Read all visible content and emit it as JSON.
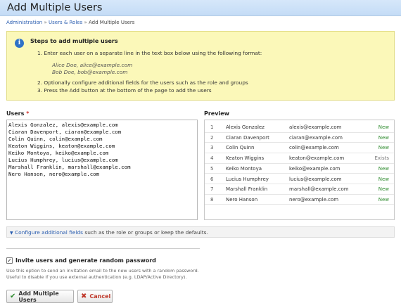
{
  "page_title": "Add Multiple Users",
  "breadcrumb": {
    "items": [
      "Administration",
      "Users & Roles",
      "Add Multiple Users"
    ],
    "separator": "»"
  },
  "notice": {
    "title": "Steps to add multiple users",
    "step1": "1.  Enter each user on a separate line in the text box below using the following format:",
    "example1": "Alice Doe, alice@example.com",
    "example2": "Bob Doe, bob@example.com",
    "step2": "2.  Optionally configure additional fields for the users such as the role and groups",
    "step3": "3.  Press the Add button at the bottom of the page to add the users"
  },
  "users": {
    "label": "Users",
    "required_marker": "*",
    "value": "Alexis Gonzalez, alexis@example.com\nCiaran Davenport, ciaran@example.com\nColin Quinn, colin@example.com\nKeaton Wiggins, keaton@example.com\nKeiko Montoya, keiko@example.com\nLucius Humphrey, lucius@example.com\nMarshall Franklin, marshall@example.com\nNero Hanson, nero@example.com"
  },
  "preview": {
    "label": "Preview",
    "rows": [
      {
        "num": "1",
        "name": "Alexis Gonzalez",
        "email": "alexis@example.com",
        "status": "New"
      },
      {
        "num": "2",
        "name": "Ciaran Davenport",
        "email": "ciaran@example.com",
        "status": "New"
      },
      {
        "num": "3",
        "name": "Colin Quinn",
        "email": "colin@example.com",
        "status": "New"
      },
      {
        "num": "4",
        "name": "Keaton Wiggins",
        "email": "keaton@example.com",
        "status": "Exists"
      },
      {
        "num": "5",
        "name": "Keiko Montoya",
        "email": "keiko@example.com",
        "status": "New"
      },
      {
        "num": "6",
        "name": "Lucius Humphrey",
        "email": "lucius@example.com",
        "status": "New"
      },
      {
        "num": "7",
        "name": "Marshall Franklin",
        "email": "marshall@example.com",
        "status": "New"
      },
      {
        "num": "8",
        "name": "Nero Hanson",
        "email": "nero@example.com",
        "status": "New"
      }
    ]
  },
  "configure": {
    "link_text": "Configure additional fields",
    "rest_text": " such as the role or groups or keep the defaults."
  },
  "invite": {
    "label": "Invite users and generate random password",
    "checked": true,
    "help_line1": "Use this option to send an invitation email to the new users with a random password.",
    "help_line2": "Useful to disable if you use external authentication (e.g. LDAP/Active Directory)."
  },
  "buttons": {
    "add_label": "Add Multiple Users",
    "cancel_label": "Cancel"
  },
  "colors": {
    "header_bg": "#c9dff7",
    "notice_bg": "#fbf8b9",
    "link": "#2a5db0",
    "status_new": "#2e8b2e",
    "status_exists": "#777777",
    "cancel": "#c0392b"
  },
  "icons": {
    "info": "info-icon",
    "add": "checkmark-icon",
    "cancel": "x-icon",
    "configure": "triangle-right-icon"
  }
}
